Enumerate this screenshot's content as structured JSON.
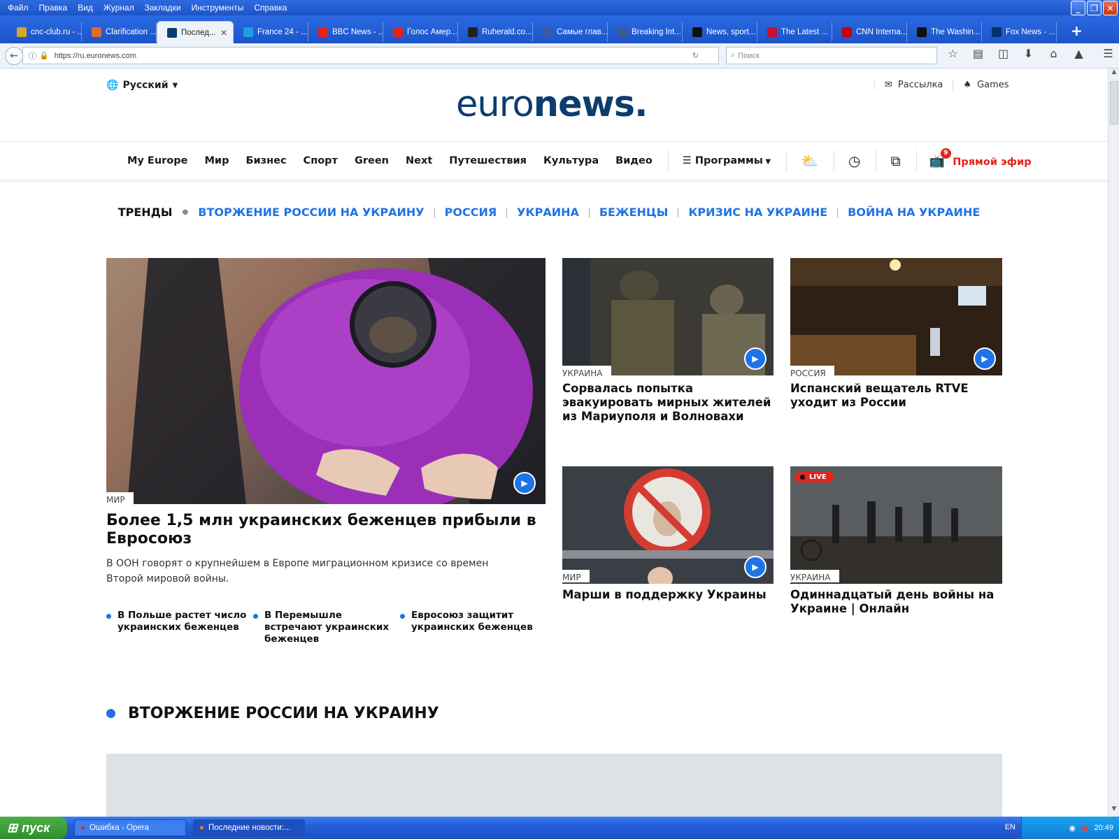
{
  "window": {
    "menu": [
      "Файл",
      "Правка",
      "Вид",
      "Журнал",
      "Закладки",
      "Инструменты",
      "Справка"
    ]
  },
  "tabs": [
    {
      "label": "cnc-club.ru - ...",
      "color": "#d9a62a"
    },
    {
      "label": "Clarification ...",
      "color": "#e06a2a"
    },
    {
      "label": "Послед...",
      "color": "#0b3d6e",
      "active": true
    },
    {
      "label": "France 24 - ...",
      "color": "#1a9fe0"
    },
    {
      "label": "BBC News - ...",
      "color": "#e62117"
    },
    {
      "label": "Голос Амер...",
      "color": "#e62117"
    },
    {
      "label": "Ruherald.co...",
      "color": "#222"
    },
    {
      "label": "Самые глав...",
      "color": "#3a5ba0"
    },
    {
      "label": "Breaking Int...",
      "color": "#3b5998"
    },
    {
      "label": "News, sport...",
      "color": "#111"
    },
    {
      "label": "The Latest ...",
      "color": "#c8102e"
    },
    {
      "label": "CNN Interna...",
      "color": "#cc0000"
    },
    {
      "label": "The Washin...",
      "color": "#111"
    },
    {
      "label": "Fox News - ...",
      "color": "#003366"
    }
  ],
  "address": {
    "url": "https://ru.euronews.com",
    "search_placeholder": "Поиск"
  },
  "site": {
    "language": "Русский",
    "logo_light": "euro",
    "logo_bold": "news.",
    "newsletter": "Рассылка",
    "games": "Games",
    "nav": [
      "My Europe",
      "Мир",
      "Бизнес",
      "Спорт",
      "Green",
      "Next",
      "Путешествия",
      "Культура",
      "Видео"
    ],
    "programs": "Программы",
    "live_badge": "9",
    "live": "Прямой эфир"
  },
  "trends": {
    "label": "ТРЕНДЫ",
    "items": [
      "ВТОРЖЕНИЕ РОССИИ НА УКРАИНУ",
      "РОССИЯ",
      "УКРАИНА",
      "БЕЖЕНЦЫ",
      "КРИЗИС НА УКРАИНЕ",
      "ВОЙНА НА УКРАИНЕ"
    ]
  },
  "main_story": {
    "category": "МИР",
    "title": "Более 1,5 млн украинских беженцев прибыли в Евросоюз",
    "summary": "В ООН говорят о крупнейшем в Европе миграционном кризисе со времен Второй мировой войны.",
    "related": [
      "В Польше растет число украинских беженцев",
      "В Перемышле встречают украинских беженцев",
      "Евросоюз защитит украинских беженцев"
    ]
  },
  "stories": [
    {
      "category": "УКРАИНА",
      "title": "Сорвалась попытка эвакуировать мирных жителей из Мариуполя и Волновахи"
    },
    {
      "category": "РОССИЯ",
      "title": "Испанский вещатель RTVE уходит из России"
    },
    {
      "category": "МИР",
      "title": "Марши в поддержку Украины"
    },
    {
      "category": "УКРАИНА",
      "title": "Одиннадцатый день войны на Украине | Онлайн",
      "live": "LIVE"
    }
  ],
  "section": {
    "title": "ВТОРЖЕНИЕ РОССИИ НА УКРАИНУ"
  },
  "taskbar": {
    "start": "пуск",
    "items": [
      "Ошибка - Opera",
      "Последние новости:..."
    ],
    "lang": "EN",
    "clock": "20:49"
  },
  "colors": {
    "accent": "#1e73e8",
    "brand": "#0b3d6e",
    "live": "#e1251b"
  }
}
